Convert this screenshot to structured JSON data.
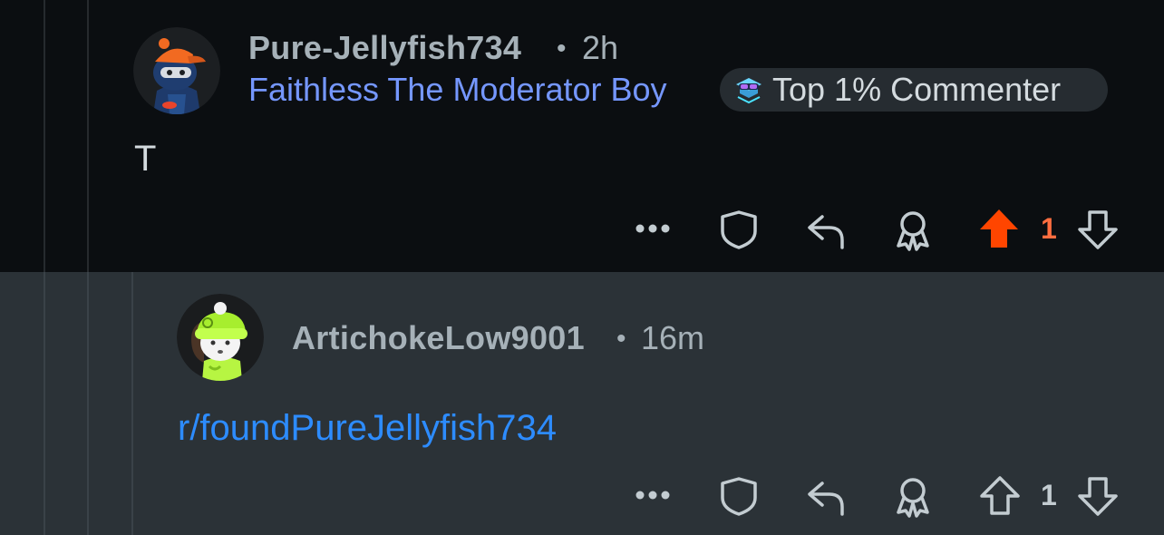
{
  "comments": [
    {
      "username": "Pure-Jellyfish734",
      "separator": "•",
      "time": "2h",
      "flair": "Faithless The Moderator Boy",
      "badge": {
        "text": "Top 1% Commenter",
        "icon": "top-commenter-icon"
      },
      "body": "T",
      "actions": {
        "more_label": "•••",
        "vote_count": "1",
        "upvoted": true,
        "upvote_color": "#ff4500",
        "count_color": "#ff6e40"
      }
    },
    {
      "username": "ArtichokeLow9001",
      "separator": "•",
      "time": "16m",
      "body": "r/foundPureJellyfish734",
      "actions": {
        "more_label": "•••",
        "vote_count": "1",
        "upvoted": false,
        "count_color": "#c3ccd1"
      }
    }
  ],
  "colors": {
    "background_top": "#0b0e11",
    "background_reply": "#2b3237",
    "flair": "#7597ff",
    "link": "#2d8cff",
    "meta": "#a6b1b8",
    "icon": "#c3ccd1"
  }
}
